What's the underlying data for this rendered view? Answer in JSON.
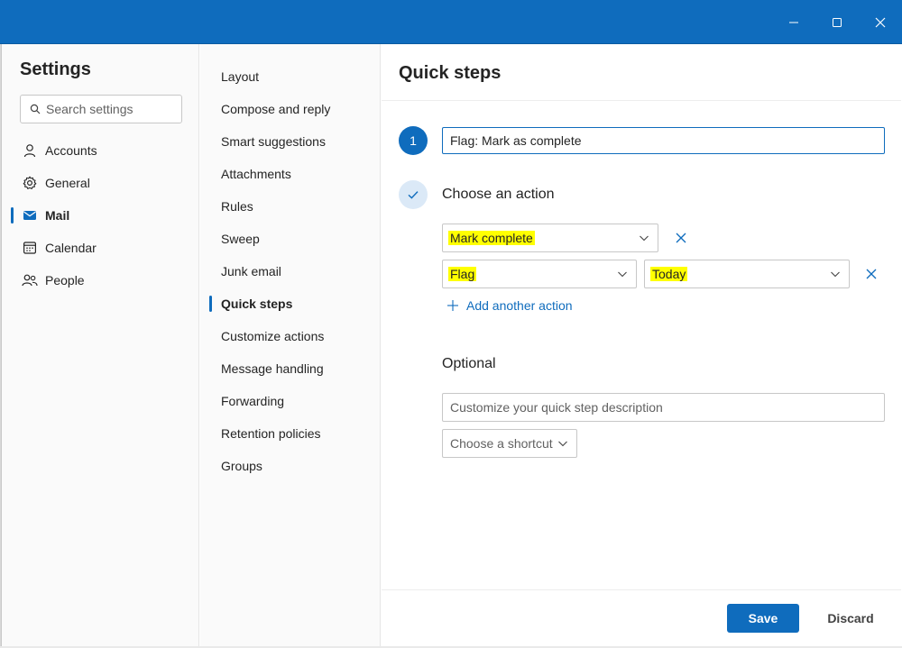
{
  "window": {
    "minimize_icon": "minimize-icon",
    "maximize_icon": "maximize-icon",
    "close_icon": "close-icon",
    "accent_color": "#0f6cbd"
  },
  "settings": {
    "title": "Settings",
    "search_placeholder": "Search settings",
    "nav": [
      {
        "label": "Accounts",
        "icon": "person-icon"
      },
      {
        "label": "General",
        "icon": "gear-icon"
      },
      {
        "label": "Mail",
        "icon": "mail-icon",
        "active": true
      },
      {
        "label": "Calendar",
        "icon": "calendar-icon"
      },
      {
        "label": "People",
        "icon": "people-icon"
      }
    ]
  },
  "mail_nav": {
    "items": [
      "Layout",
      "Compose and reply",
      "Smart suggestions",
      "Attachments",
      "Rules",
      "Sweep",
      "Junk email",
      "Quick steps",
      "Customize actions",
      "Message handling",
      "Forwarding",
      "Retention policies",
      "Groups"
    ],
    "active": "Quick steps"
  },
  "quick_steps": {
    "title": "Quick steps",
    "step1_number": "1",
    "name_value": "Flag: Mark as complete",
    "choose_action_label": "Choose an action",
    "action1": {
      "value": "Mark complete"
    },
    "action2": {
      "value": "Flag",
      "option": "Today"
    },
    "add_action_label": "Add another action",
    "optional_label": "Optional",
    "description_placeholder": "Customize your quick step description",
    "shortcut_placeholder": "Choose a shortcut",
    "save_label": "Save",
    "discard_label": "Discard",
    "highlight_color": "#ffff00"
  }
}
